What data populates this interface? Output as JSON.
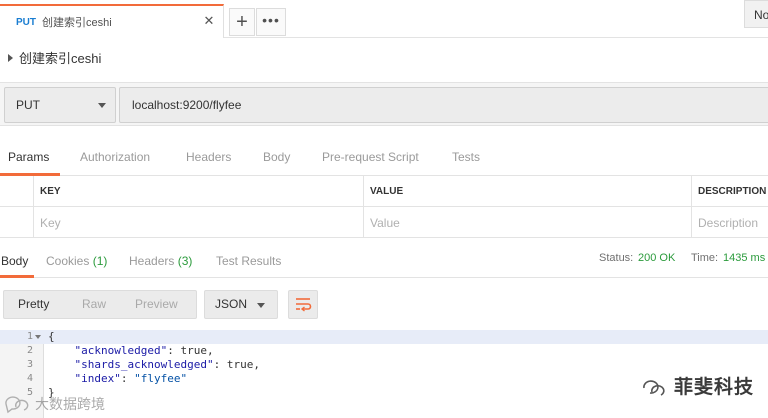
{
  "tabs": {
    "active": {
      "method": "PUT",
      "title": "创建索引ceshi",
      "close_glyph": "✕"
    },
    "new_tab_glyph": "+",
    "more_glyph": "•••",
    "environment_label": "No"
  },
  "request": {
    "name": "创建索引ceshi",
    "method": "PUT",
    "url": "localhost:9200/flyfee"
  },
  "request_tabs": [
    "Params",
    "Authorization",
    "Headers",
    "Body",
    "Pre-request Script",
    "Tests"
  ],
  "params": {
    "columns": {
      "key": "KEY",
      "value": "VALUE",
      "description": "DESCRIPTION"
    },
    "placeholders": {
      "key": "Key",
      "value": "Value",
      "description": "Description"
    }
  },
  "response": {
    "tabs": [
      {
        "label": "Body",
        "count": ""
      },
      {
        "label": "Cookies",
        "count": "(1)"
      },
      {
        "label": "Headers",
        "count": "(3)"
      },
      {
        "label": "Test Results",
        "count": ""
      }
    ],
    "status_label": "Status:",
    "status_value": "200 OK",
    "time_label": "Time:",
    "time_value": "1435 ms",
    "views": [
      "Pretty",
      "Raw",
      "Preview"
    ],
    "format": "JSON",
    "body_lines": [
      {
        "num": "1",
        "text": "{"
      },
      {
        "num": "2",
        "key": "\"acknowledged\"",
        "val": "true,"
      },
      {
        "num": "3",
        "key": "\"shards_acknowledged\"",
        "val": "true,"
      },
      {
        "num": "4",
        "key": "\"index\"",
        "val": "\"flyfee\""
      },
      {
        "num": "5",
        "text": "}"
      }
    ]
  },
  "watermarks": {
    "right": "菲斐科技",
    "left": "大数据跨境"
  },
  "colors": {
    "accent": "#f26b3a",
    "method_blue": "#1a7dd1",
    "status_green": "#2b9b3c"
  }
}
